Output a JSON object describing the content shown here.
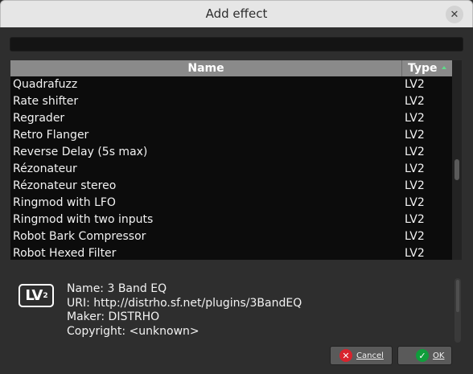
{
  "dialog": {
    "title": "Add effect"
  },
  "table": {
    "header": {
      "name": "Name",
      "type": "Type"
    },
    "rows": [
      {
        "name": "Quadrafuzz",
        "type": "LV2"
      },
      {
        "name": "Rate shifter",
        "type": "LV2"
      },
      {
        "name": "Regrader",
        "type": "LV2"
      },
      {
        "name": "Retro Flanger",
        "type": "LV2"
      },
      {
        "name": "Reverse Delay (5s max)",
        "type": "LV2"
      },
      {
        "name": "Rézonateur",
        "type": "LV2"
      },
      {
        "name": "Rézonateur stereo",
        "type": "LV2"
      },
      {
        "name": "Ringmod with LFO",
        "type": "LV2"
      },
      {
        "name": "Ringmod with two inputs",
        "type": "LV2"
      },
      {
        "name": "Robot Bark Compressor",
        "type": "LV2"
      },
      {
        "name": "Robot Hexed Filter",
        "type": "LV2"
      }
    ]
  },
  "info": {
    "logo": "LV",
    "logo_sup": "2",
    "name": "Name: 3 Band EQ",
    "uri": "URI: http://distrho.sf.net/plugins/3BandEQ",
    "maker": "Maker: DISTRHO",
    "copyright": "Copyright: <unknown>"
  },
  "buttons": {
    "cancel": "Cancel",
    "ok": "OK"
  },
  "icons": {
    "close": "close-icon",
    "cancel": "cancel-icon",
    "ok": "check-icon",
    "sort": "sort-ascending-icon"
  },
  "colors": {
    "accent_green": "#5fdc8a",
    "cancel_red": "#d8232d",
    "ok_green": "#0f9d3b"
  }
}
